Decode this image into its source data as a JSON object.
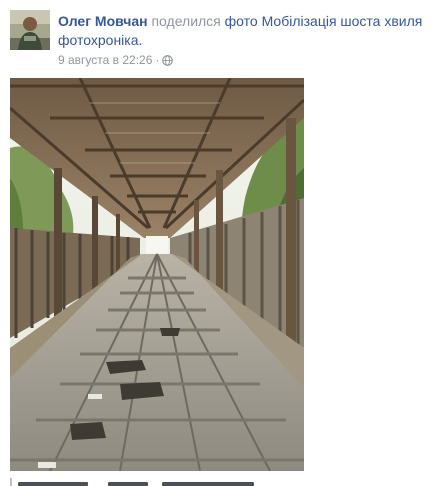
{
  "post": {
    "author": "Олег Мовчан",
    "verb": "поделился",
    "object_type": "фото",
    "object_title": "Мобілізація шоста хвиля фотохроніка.",
    "timestamp": "9 августа в 22:26",
    "separator": "·",
    "privacy_icon": "globe-icon"
  },
  "photo": {
    "icon": "photo-image",
    "description_hint": "wooden covered footbridge"
  },
  "colors": {
    "link": "#365899",
    "muted": "#90949c",
    "text": "#1d2129"
  }
}
